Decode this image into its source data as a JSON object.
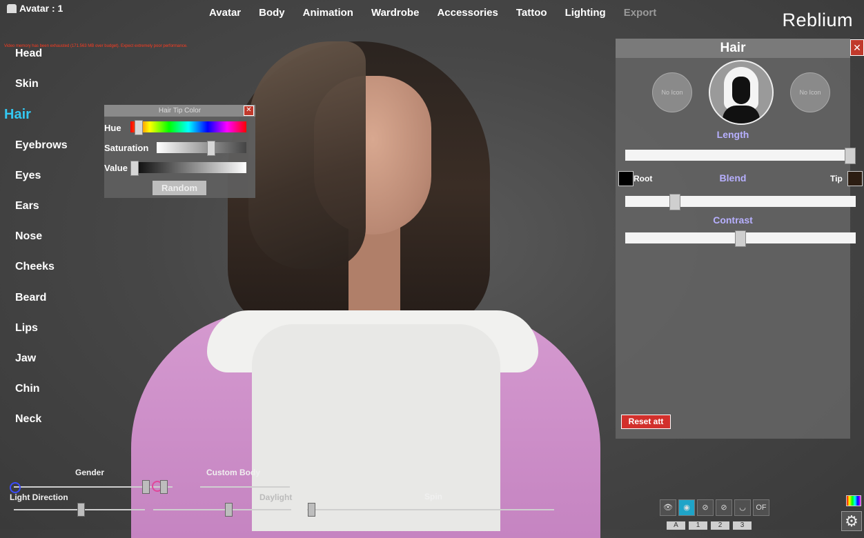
{
  "header": {
    "avatar_label": "Avatar : 1",
    "nav": [
      "Avatar",
      "Body",
      "Animation",
      "Wardrobe",
      "Accessories",
      "Tattoo",
      "Lighting",
      "Export"
    ],
    "brand_text": "Reblium",
    "warning": "Video memory has been exhausted (171.563 MB over budget). Expect extremely poor performance."
  },
  "left_menu": {
    "items": [
      "Head",
      "Skin",
      "Hair",
      "Eyebrows",
      "Eyes",
      "Ears",
      "Nose",
      "Cheeks",
      "Beard",
      "Lips",
      "Jaw",
      "Chin",
      "Neck"
    ],
    "active": "Hair"
  },
  "tip_color_panel": {
    "title": "Hair Tip Color",
    "hue_label": "Hue",
    "saturation_label": "Saturation",
    "value_label": "Value",
    "random_label": "Random",
    "hue": 0.04,
    "saturation": 0.62,
    "value": 0.0
  },
  "hair_panel": {
    "title": "Hair",
    "no_icon_left": "No Icon",
    "no_icon_right": "No Icon",
    "length_label": "Length",
    "blend_label": "Blend",
    "root_label": "Root",
    "tip_label": "Tip",
    "contrast_label": "Contrast",
    "reset_label": "Reset att",
    "length": 1.0,
    "blend": 0.2,
    "contrast": 0.5,
    "root_color": "#000000",
    "tip_color": "#2c1d12"
  },
  "bottom": {
    "gender_label": "Gender",
    "custom_body_label": "Custom Body",
    "light_direction_label": "Light Direction",
    "daylight_label": "Daylight",
    "spin_label": "Spin",
    "tabs": [
      "A",
      "1",
      "2",
      "3"
    ],
    "icon_tray": [
      "eye-icon",
      "eye-hidden-icon",
      "eye-slash-icon",
      "eye-slash-icon",
      "lips-icon",
      "off-icon"
    ]
  }
}
